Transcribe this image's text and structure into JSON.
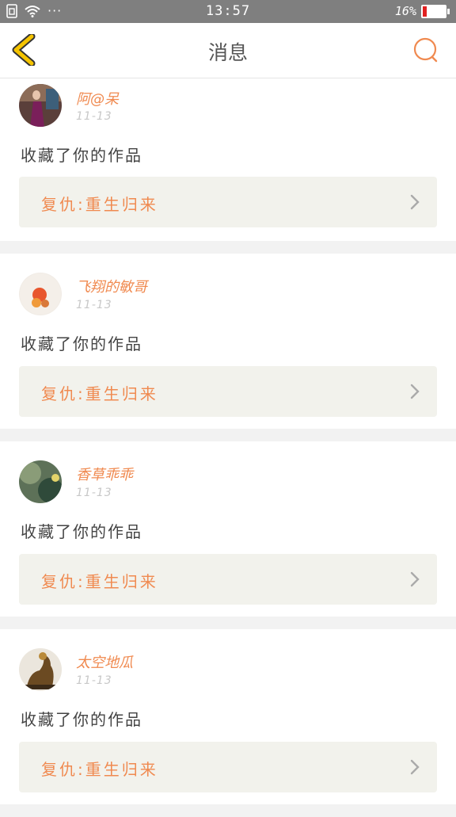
{
  "status_bar": {
    "time": "13:57",
    "battery_percent": "16%",
    "battery_level": 0.16,
    "more": "···"
  },
  "nav": {
    "title": "消息",
    "back_icon": "chevron-left-icon",
    "search_icon": "search-icon"
  },
  "colors": {
    "accent": "#f08a50",
    "back": "#f5c400",
    "statusbar": "#7f7f7f"
  },
  "messages": [
    {
      "user": "阿@呆",
      "date": "11-13",
      "action": "收藏了你的作品",
      "work": "复仇:重生归来"
    },
    {
      "user": "飞翔的敏哥",
      "date": "11-13",
      "action": "收藏了你的作品",
      "work": "复仇:重生归来"
    },
    {
      "user": "香草乖乖",
      "date": "11-13",
      "action": "收藏了你的作品",
      "work": "复仇:重生归来"
    },
    {
      "user": "太空地瓜",
      "date": "11-13",
      "action": "收藏了你的作品",
      "work": "复仇:重生归来"
    }
  ]
}
